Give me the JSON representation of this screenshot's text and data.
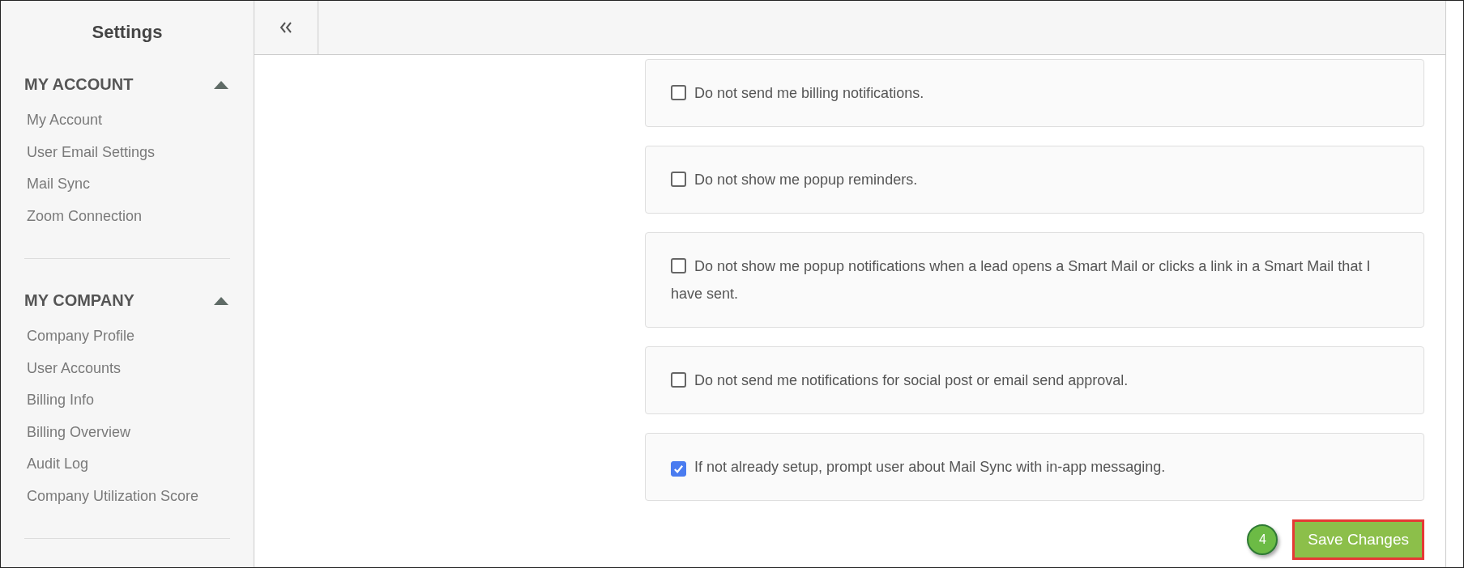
{
  "sidebar": {
    "title": "Settings",
    "sections": [
      {
        "heading": "MY ACCOUNT",
        "expanded": true,
        "items": [
          {
            "label": "My Account"
          },
          {
            "label": "User Email Settings"
          },
          {
            "label": "Mail Sync"
          },
          {
            "label": "Zoom Connection"
          }
        ]
      },
      {
        "heading": "MY COMPANY",
        "expanded": true,
        "items": [
          {
            "label": "Company Profile"
          },
          {
            "label": "User Accounts"
          },
          {
            "label": "Billing Info"
          },
          {
            "label": "Billing Overview"
          },
          {
            "label": "Audit Log"
          },
          {
            "label": "Company Utilization Score"
          }
        ]
      }
    ]
  },
  "options": [
    {
      "label": "Do not send me billing notifications.",
      "checked": false
    },
    {
      "label": "Do not show me popup reminders.",
      "checked": false
    },
    {
      "label": "Do not show me popup notifications when a lead opens a Smart Mail or clicks a link in a Smart Mail that I have sent.",
      "checked": false
    },
    {
      "label": "Do not send me notifications for social post or email send approval.",
      "checked": false
    },
    {
      "label": "If not already setup, prompt user about Mail Sync with in-app messaging.",
      "checked": true
    }
  ],
  "save_button": {
    "label": "Save Changes",
    "highlighted": true
  },
  "step_badge": "4"
}
